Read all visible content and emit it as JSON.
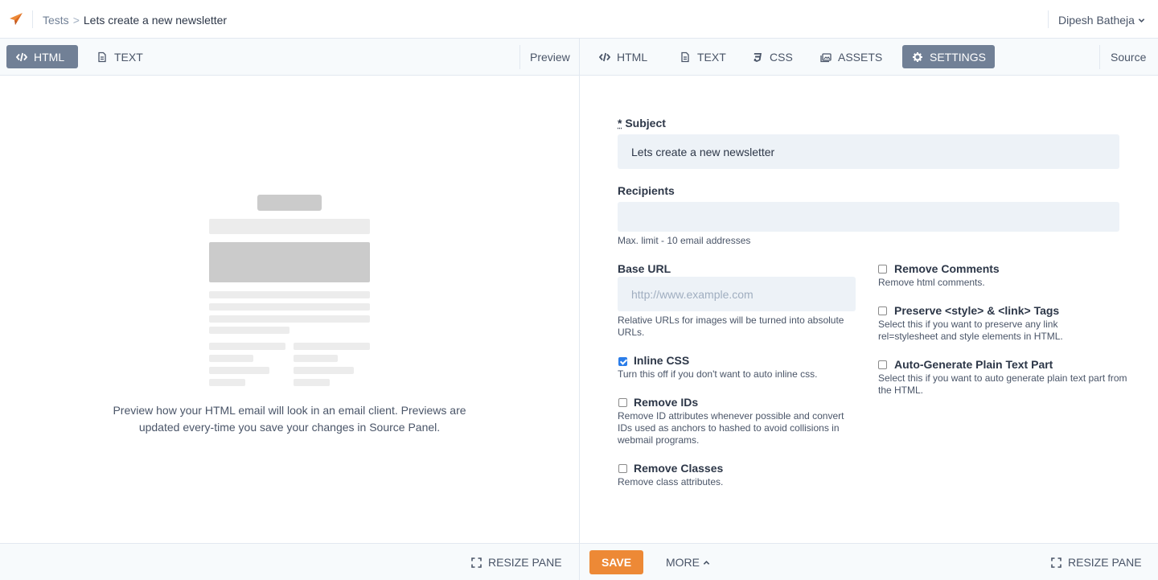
{
  "header": {
    "breadcrumb_parent": "Tests",
    "breadcrumb_separator": ">",
    "breadcrumb_current": "Lets create a new newsletter",
    "user_name": "Dipesh Batheja",
    "logo_icon": "paper-plane-icon",
    "brand_color": "#ed8936"
  },
  "left_tabs": {
    "html": "HTML",
    "text": "TEXT",
    "pane_label": "Preview"
  },
  "right_tabs": {
    "html": "HTML",
    "text": "TEXT",
    "css": "CSS",
    "assets": "ASSETS",
    "settings": "SETTINGS",
    "pane_label": "Source",
    "active": "SETTINGS"
  },
  "preview": {
    "message": "Preview how your HTML email will look in an email client. Previews are updated every-time you save your changes in Source Panel."
  },
  "settings": {
    "subject_label_req": "*",
    "subject_label": "Subject",
    "subject_value": "Lets create a new newsletter",
    "recipients_label": "Recipients",
    "recipients_value": "",
    "recipients_help": "Max. limit - 10 email addresses",
    "base_url_label": "Base URL",
    "base_url_placeholder": "http://www.example.com",
    "base_url_help": "Relative URLs for images will be turned into absolute URLs.",
    "inline_css": {
      "label": "Inline CSS",
      "help": "Turn this off if you don't want to auto inline css.",
      "checked": true
    },
    "remove_ids": {
      "label": "Remove IDs",
      "help": "Remove ID attributes whenever possible and convert IDs used as anchors to hashed to avoid collisions in webmail programs.",
      "checked": false
    },
    "remove_classes": {
      "label": "Remove Classes",
      "help": "Remove class attributes.",
      "checked": false
    },
    "remove_comments": {
      "label": "Remove Comments",
      "help": "Remove html comments.",
      "checked": false
    },
    "preserve_tags": {
      "label": "Preserve <style> & <link> Tags",
      "help": "Select this if you want to preserve any link rel=stylesheet and style elements in HTML.",
      "checked": false
    },
    "auto_plain_text": {
      "label": "Auto-Generate Plain Text Part",
      "help": "Select this if you want to auto generate plain text part from the HTML.",
      "checked": false
    }
  },
  "footer": {
    "resize_left": "RESIZE PANE",
    "save": "SAVE",
    "more": "MORE",
    "resize_right": "RESIZE PANE"
  }
}
